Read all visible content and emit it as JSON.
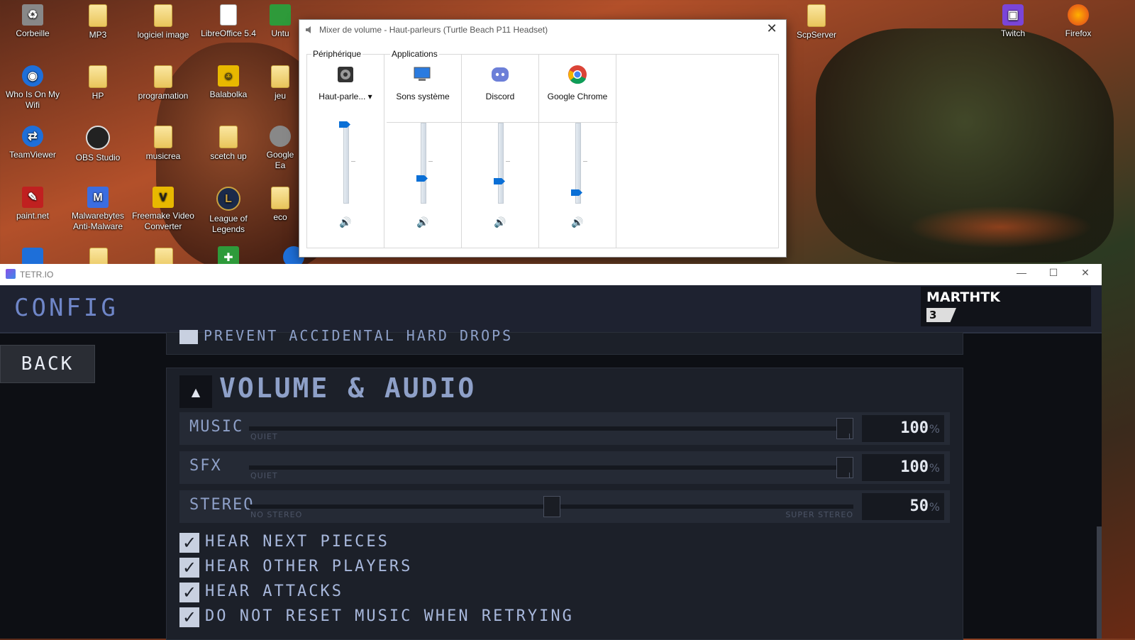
{
  "desktop": {
    "icons": [
      {
        "label": "Corbeille",
        "glyph": "recycle-bin-icon"
      },
      {
        "label": "MP3",
        "glyph": "folder-icon"
      },
      {
        "label": "logiciel image",
        "glyph": "folder-icon"
      },
      {
        "label": "LibreOffice 5.4",
        "glyph": "libreoffice-icon"
      },
      {
        "label": "Untu",
        "glyph": "app-icon"
      },
      {
        "label": "ScpServer",
        "glyph": "folder-icon"
      },
      {
        "label": "Twitch",
        "glyph": "twitch-icon"
      },
      {
        "label": "Firefox",
        "glyph": "firefox-icon"
      },
      {
        "label": "Who Is On My Wifi",
        "glyph": "wifi-watcher-icon"
      },
      {
        "label": "HP",
        "glyph": "folder-icon"
      },
      {
        "label": "programation",
        "glyph": "folder-icon"
      },
      {
        "label": "Balabolka",
        "glyph": "balabolka-icon"
      },
      {
        "label": "jeu",
        "glyph": "folder-icon"
      },
      {
        "label": "TeamViewer",
        "glyph": "teamviewer-icon"
      },
      {
        "label": "OBS Studio",
        "glyph": "obs-icon"
      },
      {
        "label": "musicrea",
        "glyph": "folder-icon"
      },
      {
        "label": "scetch up",
        "glyph": "folder-icon"
      },
      {
        "label": "Google Ea",
        "glyph": "google-earth-icon"
      },
      {
        "label": "paint.net",
        "glyph": "paintnet-icon"
      },
      {
        "label": "Malwarebytes Anti-Malware",
        "glyph": "malwarebytes-icon"
      },
      {
        "label": "Freemake Video Converter",
        "glyph": "freemake-icon"
      },
      {
        "label": "League of Legends",
        "glyph": "league-icon"
      },
      {
        "label": "eco",
        "glyph": "folder-icon"
      }
    ]
  },
  "mixer": {
    "title": "Mixer de volume - Haut-parleurs (Turtle Beach P11 Headset)",
    "device_group": "Périphérique",
    "apps_group": "Applications",
    "device": {
      "name": "Haut-parle...",
      "dropdown": "▾",
      "level": 1.0
    },
    "apps": [
      {
        "name": "Sons système",
        "level": 0.3
      },
      {
        "name": "Discord",
        "level": 0.26
      },
      {
        "name": "Google Chrome",
        "level": 0.11
      }
    ],
    "close": "✕"
  },
  "tetr": {
    "window_title": "TETR.IO",
    "header": "CONFIG",
    "user": {
      "name": "MARTHTK",
      "level": "3"
    },
    "back": "BACK",
    "prev_option": "PREVENT ACCIDENTAL HARD DROPS",
    "section": "VOLUME & AUDIO",
    "sliders": [
      {
        "label": "MUSIC",
        "hint_left": "QUIET",
        "hint_right": "L",
        "value": "100",
        "fraction": 1.0
      },
      {
        "label": "SFX",
        "hint_left": "QUIET",
        "hint_right": "L",
        "value": "100",
        "fraction": 1.0
      },
      {
        "label": "STEREO",
        "hint_left": "NO STEREO",
        "hint_right": "SUPER STEREO",
        "value": "50",
        "fraction": 0.5
      }
    ],
    "percent": "%",
    "checkboxes": [
      {
        "label": "HEAR NEXT PIECES",
        "checked": true
      },
      {
        "label": "HEAR OTHER PLAYERS",
        "checked": true
      },
      {
        "label": "HEAR ATTACKS",
        "checked": true
      },
      {
        "label": "DO NOT RESET MUSIC WHEN RETRYING",
        "checked": true
      }
    ]
  }
}
